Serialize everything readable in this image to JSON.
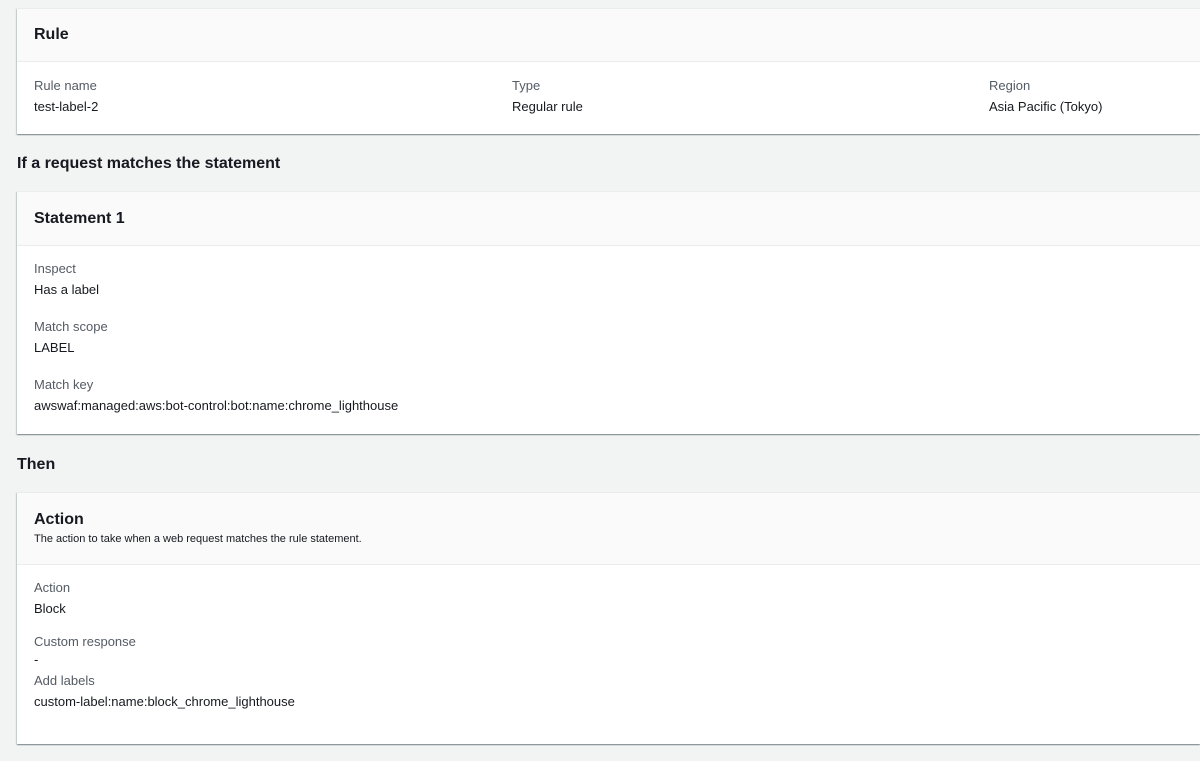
{
  "rule_panel": {
    "title": "Rule",
    "fields": [
      {
        "label": "Rule name",
        "value": "test-label-2"
      },
      {
        "label": "Type",
        "value": "Regular rule"
      },
      {
        "label": "Region",
        "value": "Asia Pacific (Tokyo)"
      }
    ]
  },
  "if_heading": "If a request matches the statement",
  "statement_panel": {
    "title": "Statement 1",
    "fields": [
      {
        "label": "Inspect",
        "value": "Has a label"
      },
      {
        "label": "Match scope",
        "value": "LABEL"
      },
      {
        "label": "Match key",
        "value": "awswaf:managed:aws:bot-control:bot:name:chrome_lighthouse"
      }
    ]
  },
  "then_heading": "Then",
  "action_panel": {
    "title": "Action",
    "description": "The action to take when a web request matches the rule statement.",
    "fields": [
      {
        "label": "Action",
        "value": "Block"
      },
      {
        "label": "Custom response",
        "value": "-"
      },
      {
        "label": "Add labels",
        "value": "custom-label:name:block_chrome_lighthouse"
      }
    ]
  }
}
